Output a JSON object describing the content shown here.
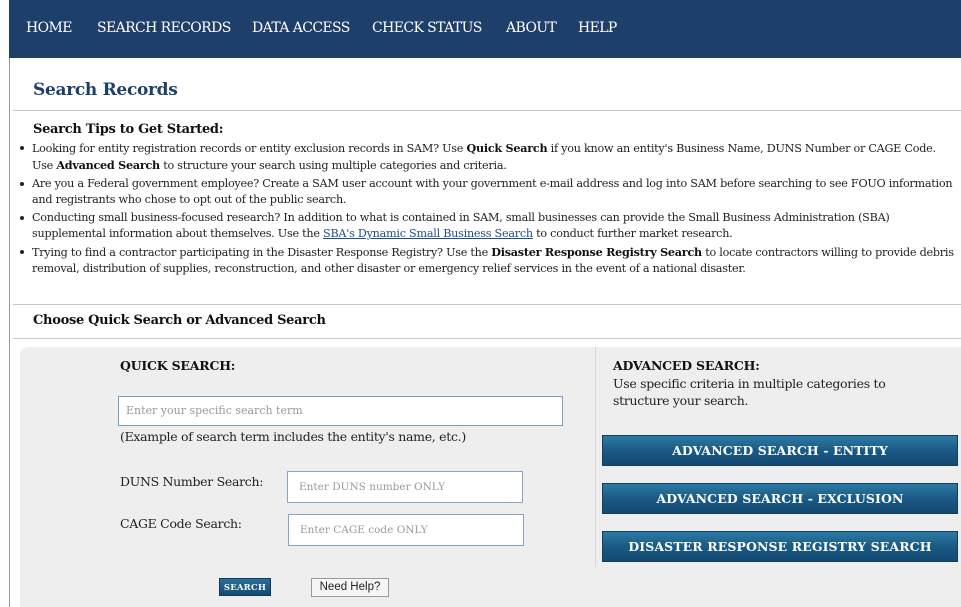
{
  "nav": {
    "items": [
      "HOME",
      "SEARCH RECORDS",
      "DATA ACCESS",
      "CHECK STATUS",
      "ABOUT",
      "HELP"
    ]
  },
  "page": {
    "title": "Search Records"
  },
  "tips": {
    "title": "Search Tips to Get Started:",
    "items": [
      {
        "a": "Looking for entity registration records or entity exclusion records in SAM? Use ",
        "b1": "Quick Search",
        "c": " if you know an entity's Business Name, DUNS Number or CAGE Code. Use ",
        "b2": "Advanced Search",
        "d": " to structure your search using multiple categories and criteria."
      },
      {
        "text": "Are you a Federal government employee? Create a SAM user account with your government e-mail address and log into SAM before searching to see FOUO information and registrants who chose to opt out of the public search."
      },
      {
        "a": "Conducting small business-focused research? In addition to what is contained in SAM, small businesses can provide the Small Business Administration (SBA) supplemental information about themselves. Use the ",
        "link": "SBA's Dynamic Small Business Search",
        "d": " to conduct further market research."
      },
      {
        "a": "Trying to find a contractor participating in the Disaster Response Registry? Use the ",
        "b1": "Disaster Response Registry Search",
        "d": " to locate contractors willing to provide debris removal, distribution of supplies, reconstruction, and other disaster or emergency relief services in the event of a national disaster."
      }
    ]
  },
  "choose": {
    "title": "Choose Quick Search or Advanced Search"
  },
  "quick_search": {
    "title": "QUICK SEARCH:",
    "placeholder": "Enter your specific search term",
    "example": "(Example of search term includes the entity's name, etc.)",
    "duns_label": "DUNS Number Search:",
    "duns_placeholder": "Enter DUNS number ONLY",
    "cage_label": "CAGE Code Search:",
    "cage_placeholder": "Enter CAGE code ONLY",
    "search_button": "SEARCH",
    "help_button": "Need Help?"
  },
  "advanced_search": {
    "title": "ADVANCED SEARCH:",
    "description": "Use specific criteria in multiple categories to structure your search.",
    "buttons": [
      "ADVANCED SEARCH - ENTITY",
      "ADVANCED SEARCH - EXCLUSION",
      "DISASTER RESPONSE REGISTRY SEARCH"
    ]
  },
  "colors": {
    "nav_bg": "#1f3f6b",
    "button_blue": "#1a5a85",
    "panel_bg": "#eeeeee"
  }
}
